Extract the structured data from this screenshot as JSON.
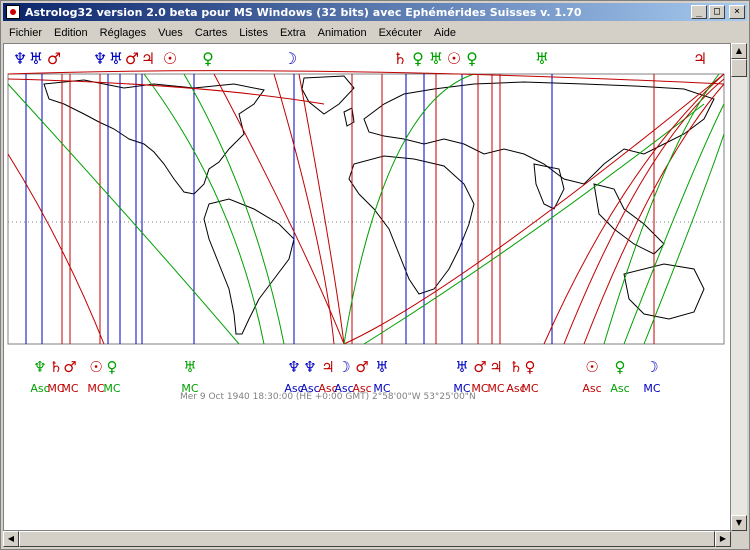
{
  "window": {
    "title": "Astrolog32 version 2.0 beta pour MS Windows (32 bits) avec Ephémérides Suisses v. 1.70",
    "controls": {
      "minimize": "_",
      "maximize": "□",
      "close": "×"
    }
  },
  "menu": [
    "Fichier",
    "Edition",
    "Réglages",
    "Vues",
    "Cartes",
    "Listes",
    "Extra",
    "Animation",
    "Exécuter",
    "Aide"
  ],
  "chart": {
    "status_line": "Mer  9 Oct 1940 18:30:00 (HE +0:00 GMT)   2°58'00\"W 53°25'00\"N",
    "top_glyphs": [
      {
        "g": "♆",
        "c": "#0000c0"
      },
      {
        "g": "♅",
        "c": "#0000c0"
      },
      {
        "g": "♂",
        "c": "#c00000"
      },
      {
        "g": "♆",
        "c": "#0000c0"
      },
      {
        "g": "♅",
        "c": "#0000c0"
      },
      {
        "g": "♂",
        "c": "#c00000"
      },
      {
        "g": "♃",
        "c": "#c00000"
      },
      {
        "g": "☉",
        "c": "#c00000"
      },
      {
        "g": "♀",
        "c": "#00a000"
      },
      {
        "g": "☽",
        "c": "#0000c0"
      },
      {
        "g": "♄",
        "c": "#c00000"
      },
      {
        "g": "♀",
        "c": "#00a000"
      },
      {
        "g": "♅",
        "c": "#00a000"
      },
      {
        "g": "☉",
        "c": "#c00000"
      },
      {
        "g": "♀",
        "c": "#00a000"
      },
      {
        "g": "♅",
        "c": "#00a000"
      },
      {
        "g": "♃",
        "c": "#c00000"
      }
    ],
    "bottom_glyphs": [
      {
        "g": "♆",
        "c": "#00a000"
      },
      {
        "g": "♄",
        "c": "#c00000"
      },
      {
        "g": "♂",
        "c": "#c00000"
      },
      {
        "g": "☉",
        "c": "#c00000"
      },
      {
        "g": "♀",
        "c": "#00a000"
      },
      {
        "g": "♅",
        "c": "#00a000"
      },
      {
        "g": "♆",
        "c": "#0000c0"
      },
      {
        "g": "♆",
        "c": "#0000c0"
      },
      {
        "g": "♃",
        "c": "#c00000"
      },
      {
        "g": "☽",
        "c": "#0000c0"
      },
      {
        "g": "♂",
        "c": "#c00000"
      },
      {
        "g": "♅",
        "c": "#0000c0"
      },
      {
        "g": "♅",
        "c": "#0000c0"
      },
      {
        "g": "♂",
        "c": "#c00000"
      },
      {
        "g": "♃",
        "c": "#c00000"
      },
      {
        "g": "♄",
        "c": "#c00000"
      },
      {
        "g": "♀",
        "c": "#c00000"
      },
      {
        "g": "☉",
        "c": "#c00000"
      },
      {
        "g": "♀",
        "c": "#00a000"
      },
      {
        "g": "☽",
        "c": "#0000c0"
      }
    ],
    "bottom_labels": [
      {
        "t": "Asc",
        "c": "#00a000"
      },
      {
        "t": "MC",
        "c": "#c00000"
      },
      {
        "t": "MC",
        "c": "#c00000"
      },
      {
        "t": "MC",
        "c": "#c00000"
      },
      {
        "t": "MC",
        "c": "#00a000"
      },
      {
        "t": "MC",
        "c": "#00a000"
      },
      {
        "t": "Asc",
        "c": "#0000c0"
      },
      {
        "t": "Asc",
        "c": "#0000c0"
      },
      {
        "t": "Asc",
        "c": "#c00000"
      },
      {
        "t": "Asc",
        "c": "#0000c0"
      },
      {
        "t": "Asc",
        "c": "#c00000"
      },
      {
        "t": "MC",
        "c": "#0000c0"
      },
      {
        "t": "MC",
        "c": "#0000c0"
      },
      {
        "t": "MC",
        "c": "#c00000"
      },
      {
        "t": "MC",
        "c": "#c00000"
      },
      {
        "t": "Asc",
        "c": "#c00000"
      },
      {
        "t": "MC",
        "c": "#c00000"
      },
      {
        "t": "Asc",
        "c": "#c00000"
      },
      {
        "t": "Asc",
        "c": "#00a000"
      },
      {
        "t": "MC",
        "c": "#0000c0"
      }
    ],
    "colors": {
      "red": "#c00000",
      "green": "#00a000",
      "blue": "#0000c0",
      "map": "#000000"
    }
  }
}
